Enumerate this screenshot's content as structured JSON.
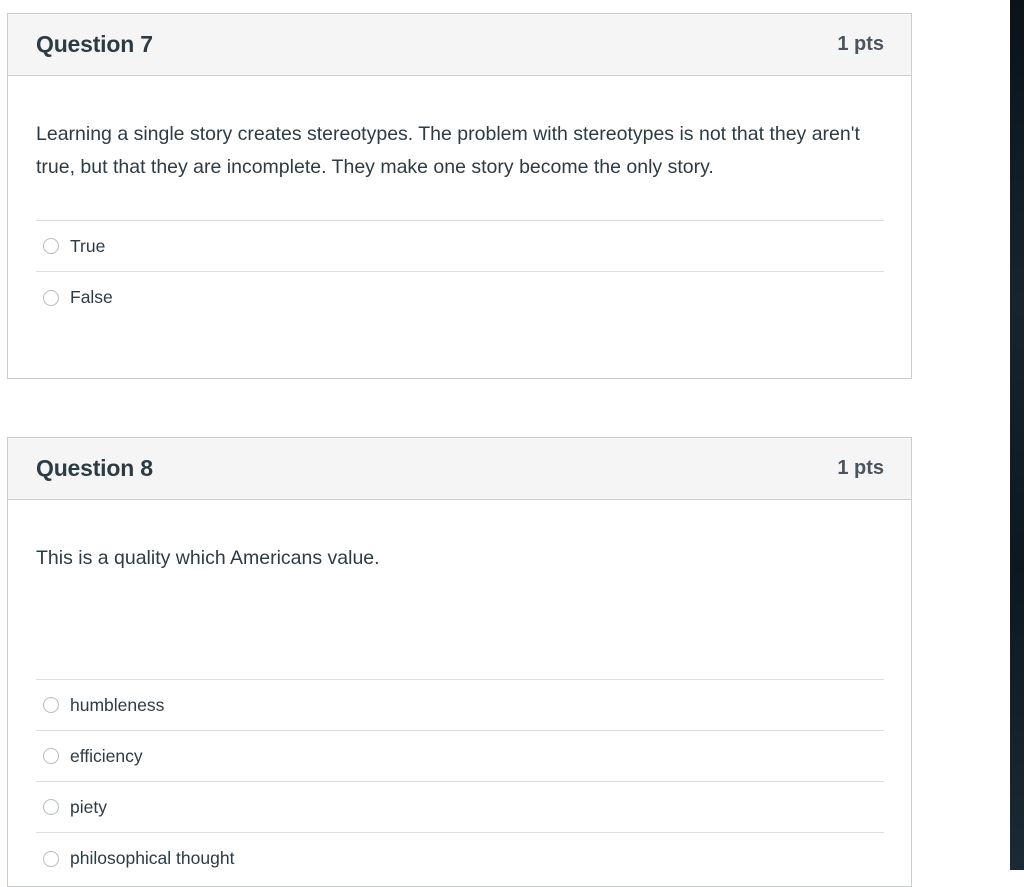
{
  "questions": [
    {
      "title": "Question 7",
      "points": "1 pts",
      "text": "Learning a single story creates stereotypes.  The problem with stereotypes is not that they aren't true, but that they are incomplete.  They make one story become the only story.",
      "answers": [
        "True",
        "False"
      ]
    },
    {
      "title": "Question 8",
      "points": "1 pts",
      "text": "This is a quality which Americans value.",
      "answers": [
        "humbleness",
        "efficiency",
        "piety",
        "philosophical thought"
      ]
    }
  ]
}
